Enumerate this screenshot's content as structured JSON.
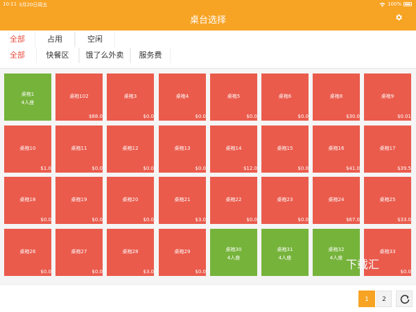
{
  "status_bar": {
    "time": "10:11",
    "date": "3月20日周五",
    "battery": "100%"
  },
  "header": {
    "title": "桌台选择"
  },
  "filters": {
    "status_tabs": [
      "全部",
      "占用",
      "空闲"
    ],
    "area_tabs": [
      "全部",
      "快餐区",
      "饿了么外卖",
      "服务费"
    ]
  },
  "tables": [
    {
      "name": "桌袍1",
      "seats": "4人座",
      "price": "",
      "status": "idle"
    },
    {
      "name": "桌袍102",
      "seats": "",
      "price": "$88.0",
      "status": "occupied"
    },
    {
      "name": "桌袍3",
      "seats": "",
      "price": "$0.0",
      "status": "occupied"
    },
    {
      "name": "桌袍4",
      "seats": "",
      "price": "$0.0",
      "status": "occupied"
    },
    {
      "name": "桌袍5",
      "seats": "",
      "price": "$0.0",
      "status": "occupied"
    },
    {
      "name": "桌袍6",
      "seats": "",
      "price": "$0.0",
      "status": "occupied"
    },
    {
      "name": "桌袍8",
      "seats": "",
      "price": "$30.0",
      "status": "occupied"
    },
    {
      "name": "桌袍9",
      "seats": "",
      "price": "$0.01",
      "status": "occupied"
    },
    {
      "name": "桌袍10",
      "seats": "",
      "price": "$1.0",
      "status": "occupied"
    },
    {
      "name": "桌袍11",
      "seats": "",
      "price": "$0.0",
      "status": "occupied"
    },
    {
      "name": "桌袍12",
      "seats": "",
      "price": "$0.0",
      "status": "occupied"
    },
    {
      "name": "桌袍13",
      "seats": "",
      "price": "$0.0",
      "status": "occupied"
    },
    {
      "name": "桌袍14",
      "seats": "",
      "price": "$12.0",
      "status": "occupied"
    },
    {
      "name": "桌袍15",
      "seats": "",
      "price": "$0.0",
      "status": "occupied"
    },
    {
      "name": "桌袍16",
      "seats": "",
      "price": "$41.0",
      "status": "occupied"
    },
    {
      "name": "桌袍17",
      "seats": "",
      "price": "$39.5",
      "status": "occupied"
    },
    {
      "name": "桌袍18",
      "seats": "",
      "price": "$0.0",
      "status": "occupied"
    },
    {
      "name": "桌袍19",
      "seats": "",
      "price": "$0.0",
      "status": "occupied"
    },
    {
      "name": "桌袍20",
      "seats": "",
      "price": "$0.0",
      "status": "occupied"
    },
    {
      "name": "桌袍21",
      "seats": "",
      "price": "$3.0",
      "status": "occupied"
    },
    {
      "name": "桌袍22",
      "seats": "",
      "price": "$0.0",
      "status": "occupied"
    },
    {
      "name": "桌袍23",
      "seats": "",
      "price": "$0.0",
      "status": "occupied"
    },
    {
      "name": "桌袍24",
      "seats": "",
      "price": "$67.0",
      "status": "occupied"
    },
    {
      "name": "桌袍25",
      "seats": "",
      "price": "$33.0",
      "status": "occupied"
    },
    {
      "name": "桌袍26",
      "seats": "",
      "price": "$0.0",
      "status": "occupied"
    },
    {
      "name": "桌袍27",
      "seats": "",
      "price": "$0.0",
      "status": "occupied"
    },
    {
      "name": "桌袍28",
      "seats": "",
      "price": "$3.0",
      "status": "occupied"
    },
    {
      "name": "桌袍29",
      "seats": "",
      "price": "$0.0",
      "status": "occupied"
    },
    {
      "name": "桌袍30",
      "seats": "4人座",
      "price": "",
      "status": "idle"
    },
    {
      "name": "桌袍31",
      "seats": "4人座",
      "price": "",
      "status": "idle"
    },
    {
      "name": "桌袍32",
      "seats": "4人座",
      "price": "",
      "status": "idle"
    },
    {
      "name": "桌袍33",
      "seats": "",
      "price": "$0.0",
      "status": "occupied"
    }
  ],
  "pagination": {
    "pages": [
      "1",
      "2"
    ],
    "current": "1"
  },
  "watermark": "下载汇",
  "colors": {
    "accent": "#f7a324",
    "occupied": "#ea5b4c",
    "idle": "#76b33b",
    "active_tab": "#e84d3d"
  },
  "icons": {
    "settings": "gear-icon",
    "refresh": "refresh-icon",
    "wifi": "wifi-icon",
    "battery": "battery-icon"
  }
}
